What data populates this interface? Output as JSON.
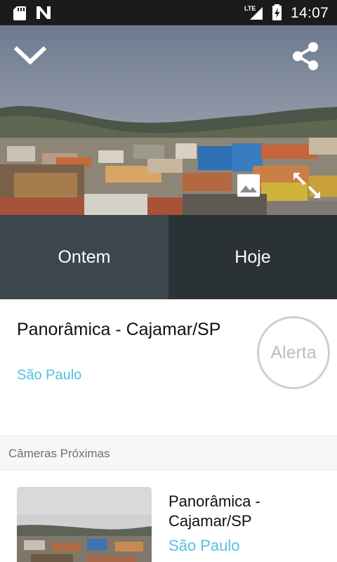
{
  "status_bar": {
    "time": "14:07",
    "network_label": "LTE",
    "icons": [
      "sd-card-icon",
      "n-notification-icon",
      "lte-signal-icon",
      "battery-charging-icon"
    ]
  },
  "hero": {
    "icons": [
      "chevron-down-icon",
      "share-icon",
      "image-gallery-icon",
      "expand-icon"
    ]
  },
  "tabs": [
    {
      "label": "Ontem"
    },
    {
      "label": "Hoje"
    }
  ],
  "camera": {
    "title": "Panorâmica - Cajamar/SP",
    "city": "São Paulo",
    "alert_label": "Alerta"
  },
  "nearby": {
    "header": "Câmeras Próximas",
    "items": [
      {
        "title": "Panorâmica - Cajamar/SP",
        "city": "São Paulo"
      }
    ]
  },
  "colors": {
    "accent": "#55bfe3",
    "tab_ontem": "#3b474c",
    "tab_hoje": "#2a3236",
    "status_bar": "#1b1b1b"
  }
}
